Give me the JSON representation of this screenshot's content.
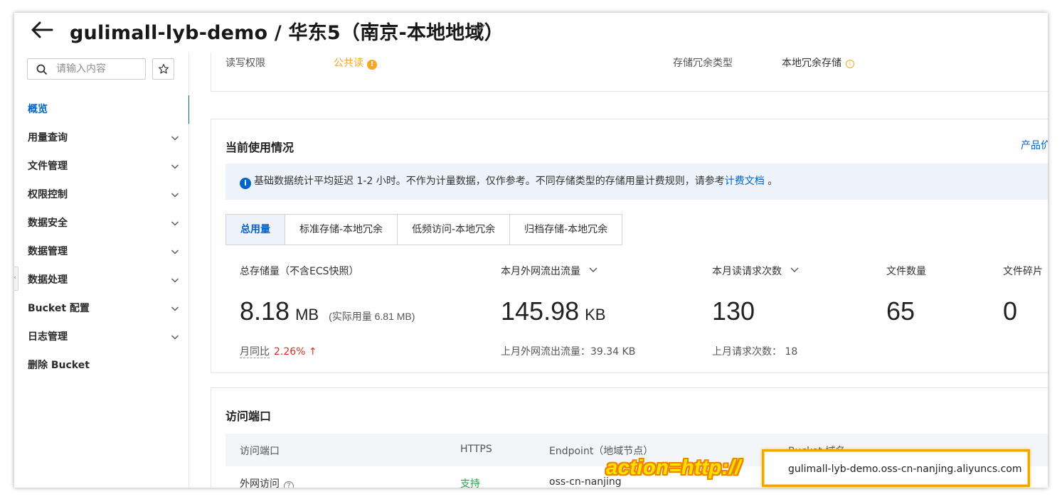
{
  "header": {
    "title": "gulimall-lyb-demo / 华东5（南京-本地地域）"
  },
  "sidebar": {
    "search_placeholder": "请输入内容",
    "items": [
      {
        "label": "概览",
        "expandable": false,
        "active": true
      },
      {
        "label": "用量查询",
        "expandable": true
      },
      {
        "label": "文件管理",
        "expandable": true
      },
      {
        "label": "权限控制",
        "expandable": true
      },
      {
        "label": "数据安全",
        "expandable": true
      },
      {
        "label": "数据管理",
        "expandable": true
      },
      {
        "label": "数据处理",
        "expandable": true
      },
      {
        "label": "Bucket 配置",
        "expandable": true
      },
      {
        "label": "日志管理",
        "expandable": true
      },
      {
        "label": "删除 Bucket",
        "expandable": false
      }
    ]
  },
  "basic_info": {
    "permission_label": "读写权限",
    "permission_value": "公共读",
    "redundancy_label": "存储冗余类型",
    "redundancy_value": "本地冗余存储"
  },
  "usage": {
    "title": "当前使用情况",
    "product_link": "产品价",
    "notice_text": "基础数据统计平均延迟 1-2 小时。不作为计量数据，仅作参考。不同存储类型的存储用量计费规则，请参考",
    "notice_link": "计费文档",
    "notice_end": " 。",
    "tabs": [
      "总用量",
      "标准存储-本地冗余",
      "低频访问-本地冗余",
      "归档存储-本地冗余"
    ],
    "metrics": {
      "storage": {
        "label": "总存储量（不含ECS快照）",
        "value": "8.18",
        "unit": "MB",
        "actual": "(实际用量 6.81 MB)",
        "yoy_label": "月同比",
        "yoy_value": "2.26%"
      },
      "outbound": {
        "label": "本月外网流出流量",
        "value": "145.98",
        "unit": "KB",
        "sub": "上月外网流出流量：39.34 KB"
      },
      "requests": {
        "label": "本月读请求次数",
        "value": "130",
        "sub": "上月请求次数：  18"
      },
      "files": {
        "label": "文件数量",
        "value": "65"
      },
      "fragments": {
        "label": "文件碎片",
        "value": "0"
      }
    }
  },
  "endpoints": {
    "title": "访问端口",
    "columns": [
      "访问端口",
      "HTTPS",
      "Endpoint（地域节点）",
      "Bucket 域名"
    ],
    "rows": [
      {
        "type": "外网访问",
        "https": "支持",
        "endpoint": "oss-cn-nanjing",
        "domain": "gulimall-lyb-demo.oss-cn-nanjing.aliyuncs.com"
      }
    ]
  },
  "annotation": {
    "text": "action=http://"
  },
  "colors": {
    "accent": "#0064c8",
    "warning": "#f5a623",
    "success": "#24a148",
    "danger": "#d93026",
    "annotation_yellow": "#ffe100",
    "annotation_orange": "#f08300"
  }
}
